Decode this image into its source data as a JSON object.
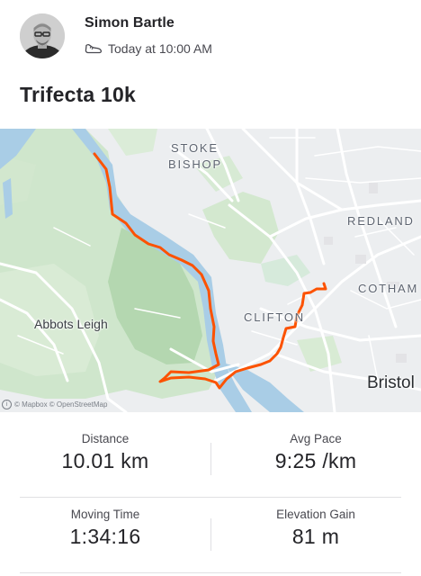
{
  "athlete": {
    "name": "Simon Bartle",
    "timestamp": "Today at 10:00 AM",
    "activity_icon": "shoe-icon"
  },
  "activity": {
    "title": "Trifecta 10k"
  },
  "map": {
    "labels": {
      "stoke": "STOKE",
      "bishop": "BISHOP",
      "redland": "REDLAND",
      "cotham": "COTHAM",
      "clifton": "CLIFTON",
      "abbots_leigh": "Abbots Leigh",
      "bristol": "Bristol"
    },
    "attribution": "© Mapbox © OpenStreetMap",
    "route_color": "#fc5200"
  },
  "stats": {
    "distance": {
      "label": "Distance",
      "value": "10.01 km"
    },
    "avg_pace": {
      "label": "Avg Pace",
      "value": "9:25 /km"
    },
    "moving_time": {
      "label": "Moving Time",
      "value": "1:34:16"
    },
    "elevation_gain": {
      "label": "Elevation Gain",
      "value": "81 m"
    }
  }
}
